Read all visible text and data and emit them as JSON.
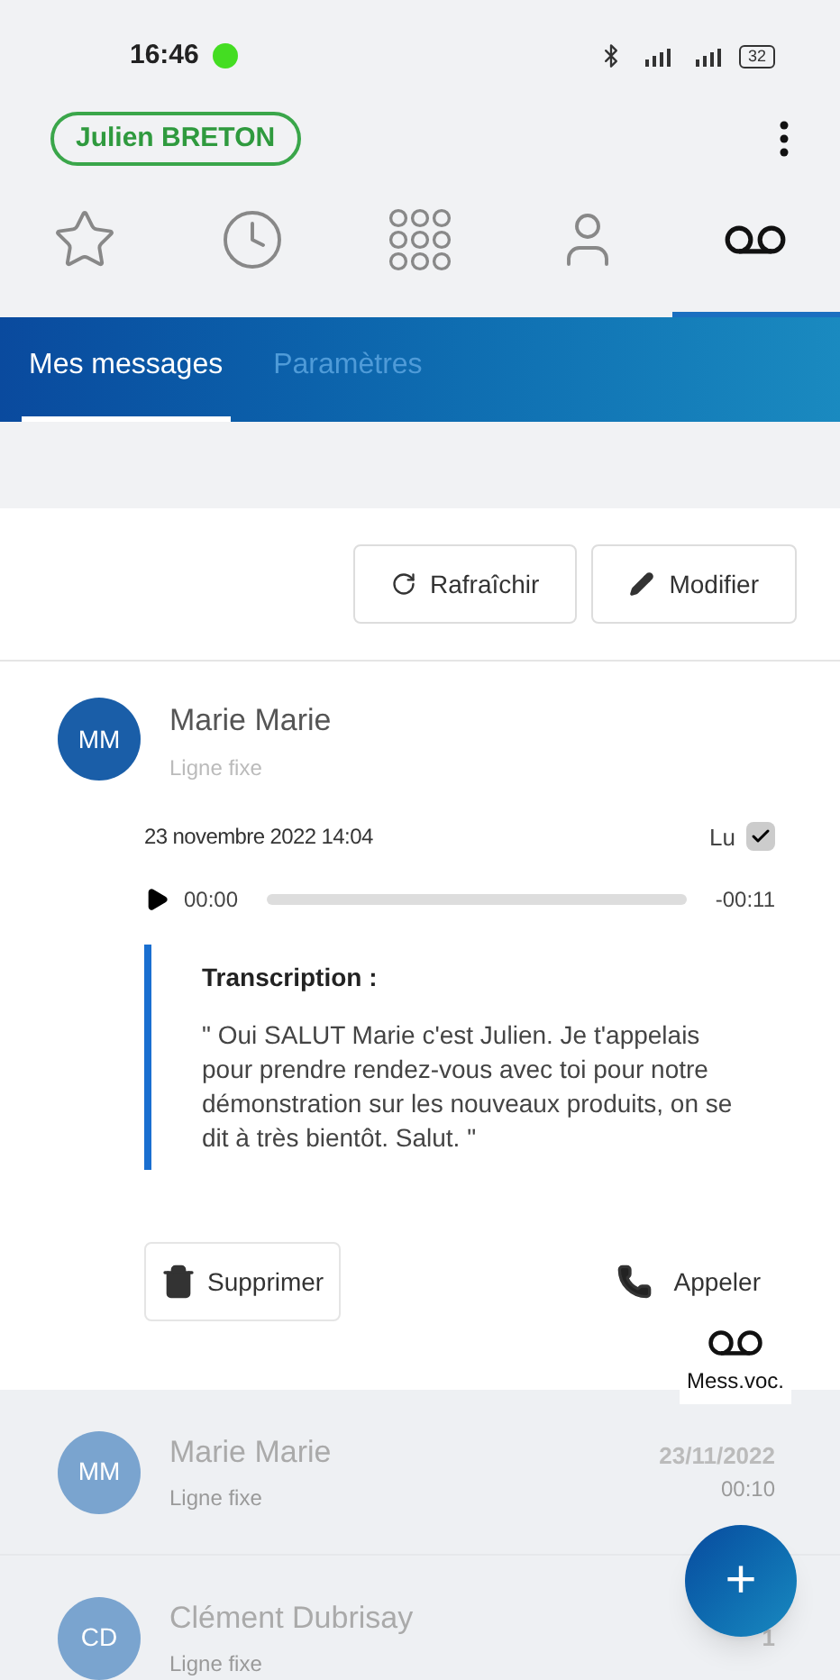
{
  "status_bar": {
    "time": "16:46",
    "battery": "32"
  },
  "header": {
    "user": "Julien BRETON"
  },
  "nav_tabs": [
    {
      "kind": "star",
      "selected": false
    },
    {
      "kind": "clock",
      "selected": false
    },
    {
      "kind": "keypad",
      "selected": false
    },
    {
      "kind": "person",
      "selected": false
    },
    {
      "kind": "voicemail",
      "selected": true
    }
  ],
  "sub_tabs": [
    {
      "label": "Mes messages",
      "selected": true
    },
    {
      "label": "Paramètres",
      "selected": false
    }
  ],
  "actions": [
    {
      "kind": "refresh",
      "label": "Rafraîchir"
    },
    {
      "kind": "edit",
      "label": "Modifier"
    }
  ],
  "open_message": {
    "initials": "MM",
    "name": "Marie Marie",
    "line": "Ligne fixe",
    "date": "23 novembre 2022 14:04",
    "read_label": "Lu",
    "read": true,
    "player": {
      "elapsed": "00:00",
      "remaining": "-00:11"
    },
    "transcription_title": "Transcription :",
    "transcription": "\" Oui SALUT Marie c'est Julien. Je t'appelais pour prendre rendez-vous avec toi pour notre démonstration sur les nouveaux produits, on se dit à très bientôt. Salut. \"",
    "delete_label": "Supprimer",
    "call_label": "Appeler"
  },
  "tooltip": {
    "label": "Mess.voc."
  },
  "messages": [
    {
      "initials": "MM",
      "name": "Marie Marie",
      "line": "Ligne fixe",
      "date": "23/11/2022",
      "duration": "00:10"
    },
    {
      "initials": "CD",
      "name": "Clément Dubrisay",
      "line": "Ligne fixe",
      "date": "1"
    }
  ],
  "fab": {
    "label": "+"
  }
}
